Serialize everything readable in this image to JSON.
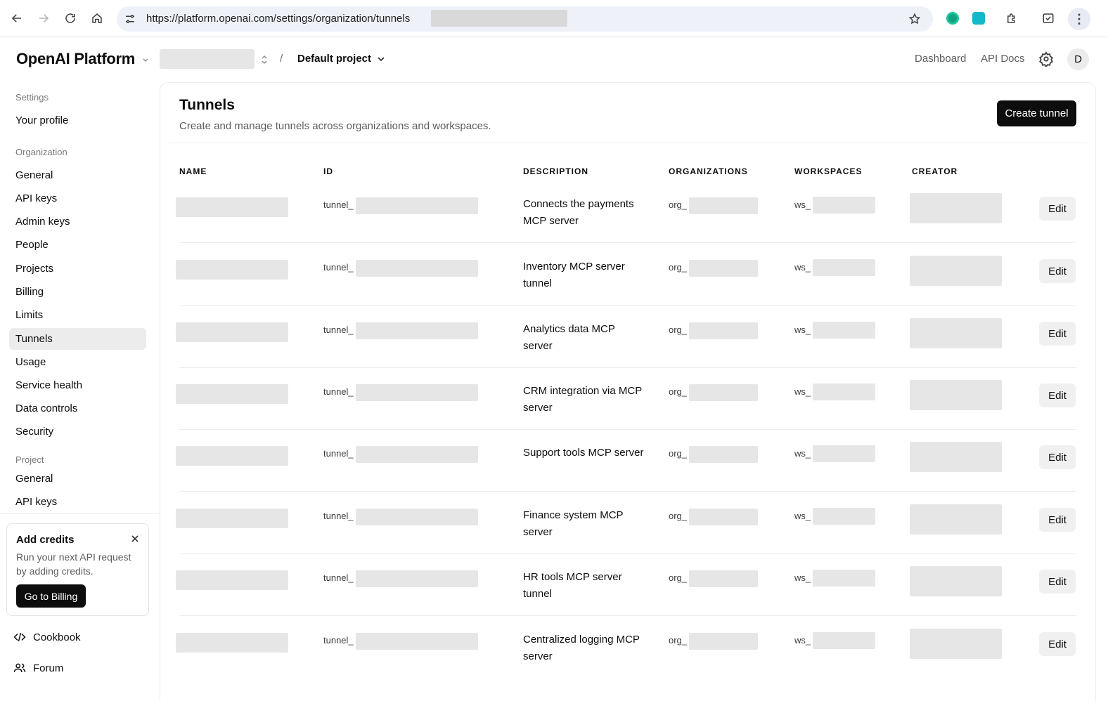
{
  "browser": {
    "url": "https://platform.openai.com/settings/organization/tunnels"
  },
  "header": {
    "logo": "OpenAI Platform",
    "separator": "/",
    "project": "Default project",
    "links": [
      "Dashboard",
      "API Docs"
    ],
    "avatar_initial": "D"
  },
  "sidebar": {
    "settings_label": "Settings",
    "profile": "Your profile",
    "organization_label": "Organization",
    "org_items": [
      "General",
      "API keys",
      "Admin keys",
      "People",
      "Projects",
      "Billing",
      "Limits",
      "Tunnels",
      "Usage",
      "Service health",
      "Data controls",
      "Security"
    ],
    "active_item": "Tunnels",
    "project_label": "Project",
    "project_items": [
      "General",
      "API keys"
    ],
    "credits": {
      "title": "Add credits",
      "text": "Run your next API request by adding credits.",
      "button": "Go to Billing"
    },
    "footer": [
      "Cookbook",
      "Forum"
    ]
  },
  "main": {
    "title": "Tunnels",
    "subtitle": "Create and manage tunnels across organizations and workspaces.",
    "create_button": "Create tunnel",
    "columns": [
      "NAME",
      "ID",
      "DESCRIPTION",
      "ORGANIZATIONS",
      "WORKSPACES",
      "CREATOR"
    ],
    "id_prefix": "tunnel_",
    "org_prefix": "org_",
    "ws_prefix": "ws_",
    "edit_label": "Edit",
    "rows": [
      {
        "description": "Connects the payments MCP server"
      },
      {
        "description": "Inventory MCP server tunnel"
      },
      {
        "description": "Analytics data MCP server"
      },
      {
        "description": "CRM integration via MCP server"
      },
      {
        "description": "Support tools MCP server"
      },
      {
        "description": "Finance system MCP server"
      },
      {
        "description": "HR tools MCP server tunnel"
      },
      {
        "description": "Centralized logging MCP server"
      }
    ]
  }
}
